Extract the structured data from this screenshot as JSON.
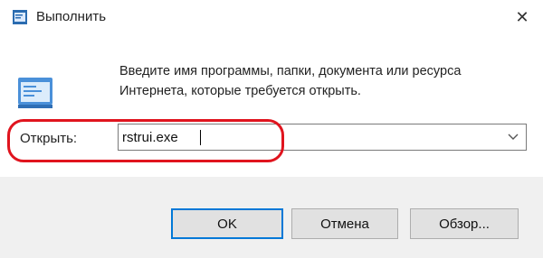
{
  "window": {
    "title": "Выполнить",
    "close_glyph": "✕",
    "icons": {
      "app": "run-app-icon",
      "close": "close-icon"
    }
  },
  "dialog": {
    "description_line1": "Введите имя программы, папки, документа или ресурса",
    "description_line2": "Интернета, которые требуется открыть.",
    "open_label": "Открыть:",
    "open_value": "rstrui.exe",
    "icons": {
      "run": "run-dialog-icon",
      "dropdown": "chevron-down-icon"
    }
  },
  "buttons": {
    "ok": "OK",
    "cancel": "Отмена",
    "browse": "Обзор..."
  },
  "colors": {
    "accent": "#0078d7",
    "highlight": "#e0141e",
    "footer_bg": "#f0f0f0"
  }
}
